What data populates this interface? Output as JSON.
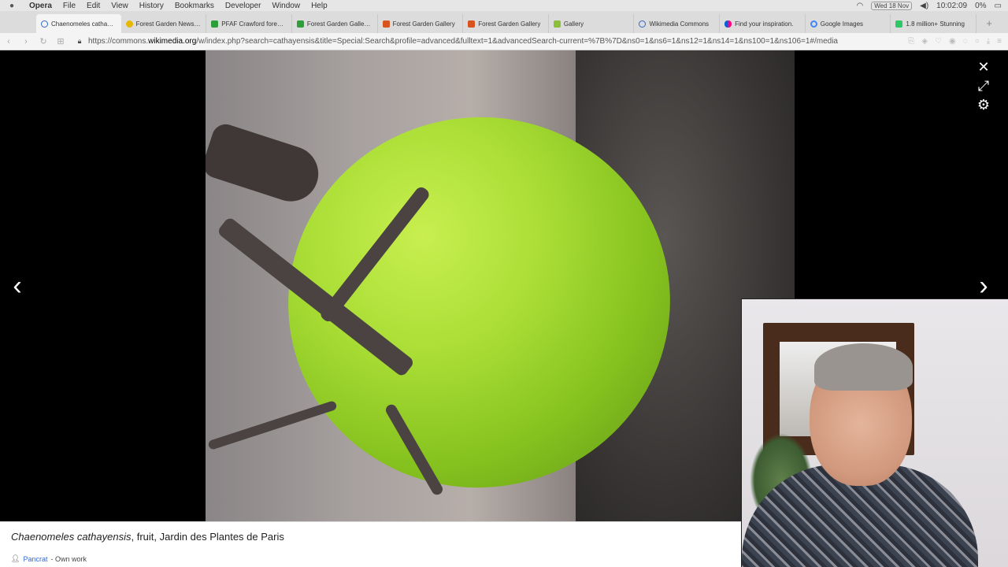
{
  "menubar": {
    "app_name": "Opera",
    "items": [
      "File",
      "Edit",
      "View",
      "History",
      "Bookmarks",
      "Developer",
      "Window",
      "Help"
    ],
    "date": "Wed 18 Nov",
    "time": "10:02:09",
    "battery": "0%"
  },
  "tabs": [
    {
      "label": "Chaenomeles cathayensis",
      "color": "#ffffff",
      "active": true
    },
    {
      "label": "Forest Garden News —",
      "color": "#e6b800"
    },
    {
      "label": "PFAF Crawford forest ga",
      "color": "#2e9e3a"
    },
    {
      "label": "Forest Garden Gallery o",
      "color": "#2e9e3a"
    },
    {
      "label": "Forest Garden Gallery",
      "color": "#d9531e"
    },
    {
      "label": "Forest Garden Gallery",
      "color": "#d9531e"
    },
    {
      "label": "Gallery",
      "color": "#8bbf3a"
    },
    {
      "label": "Wikimedia Commons",
      "color": "#3366cc"
    },
    {
      "label": "Find your inspiration.",
      "color": "#ff0084"
    },
    {
      "label": "Google Images",
      "color": "#4285f4"
    },
    {
      "label": "1.8 million+ Stunning",
      "color": "#2ec866"
    }
  ],
  "address": {
    "url_prefix": "https://commons.",
    "url_domain": "wikimedia.org",
    "url_suffix": "/w/index.php?search=cathayensis&title=Special:Search&profile=advanced&fulltext=1&advancedSearch-current=%7B%7D&ns0=1&ns6=1&ns12=1&ns14=1&ns100=1&ns106=1#/media"
  },
  "viewer": {
    "close_glyph": "✕",
    "fullscreen_glyph": "⤢",
    "settings_glyph": "⚙",
    "prev_glyph": "‹",
    "next_glyph": "›"
  },
  "caption": {
    "species": "Chaenomeles cathayensis",
    "description": ", fruit, Jardin des Plantes de Paris",
    "author": "Pancrat",
    "license_text": " - Own work"
  }
}
